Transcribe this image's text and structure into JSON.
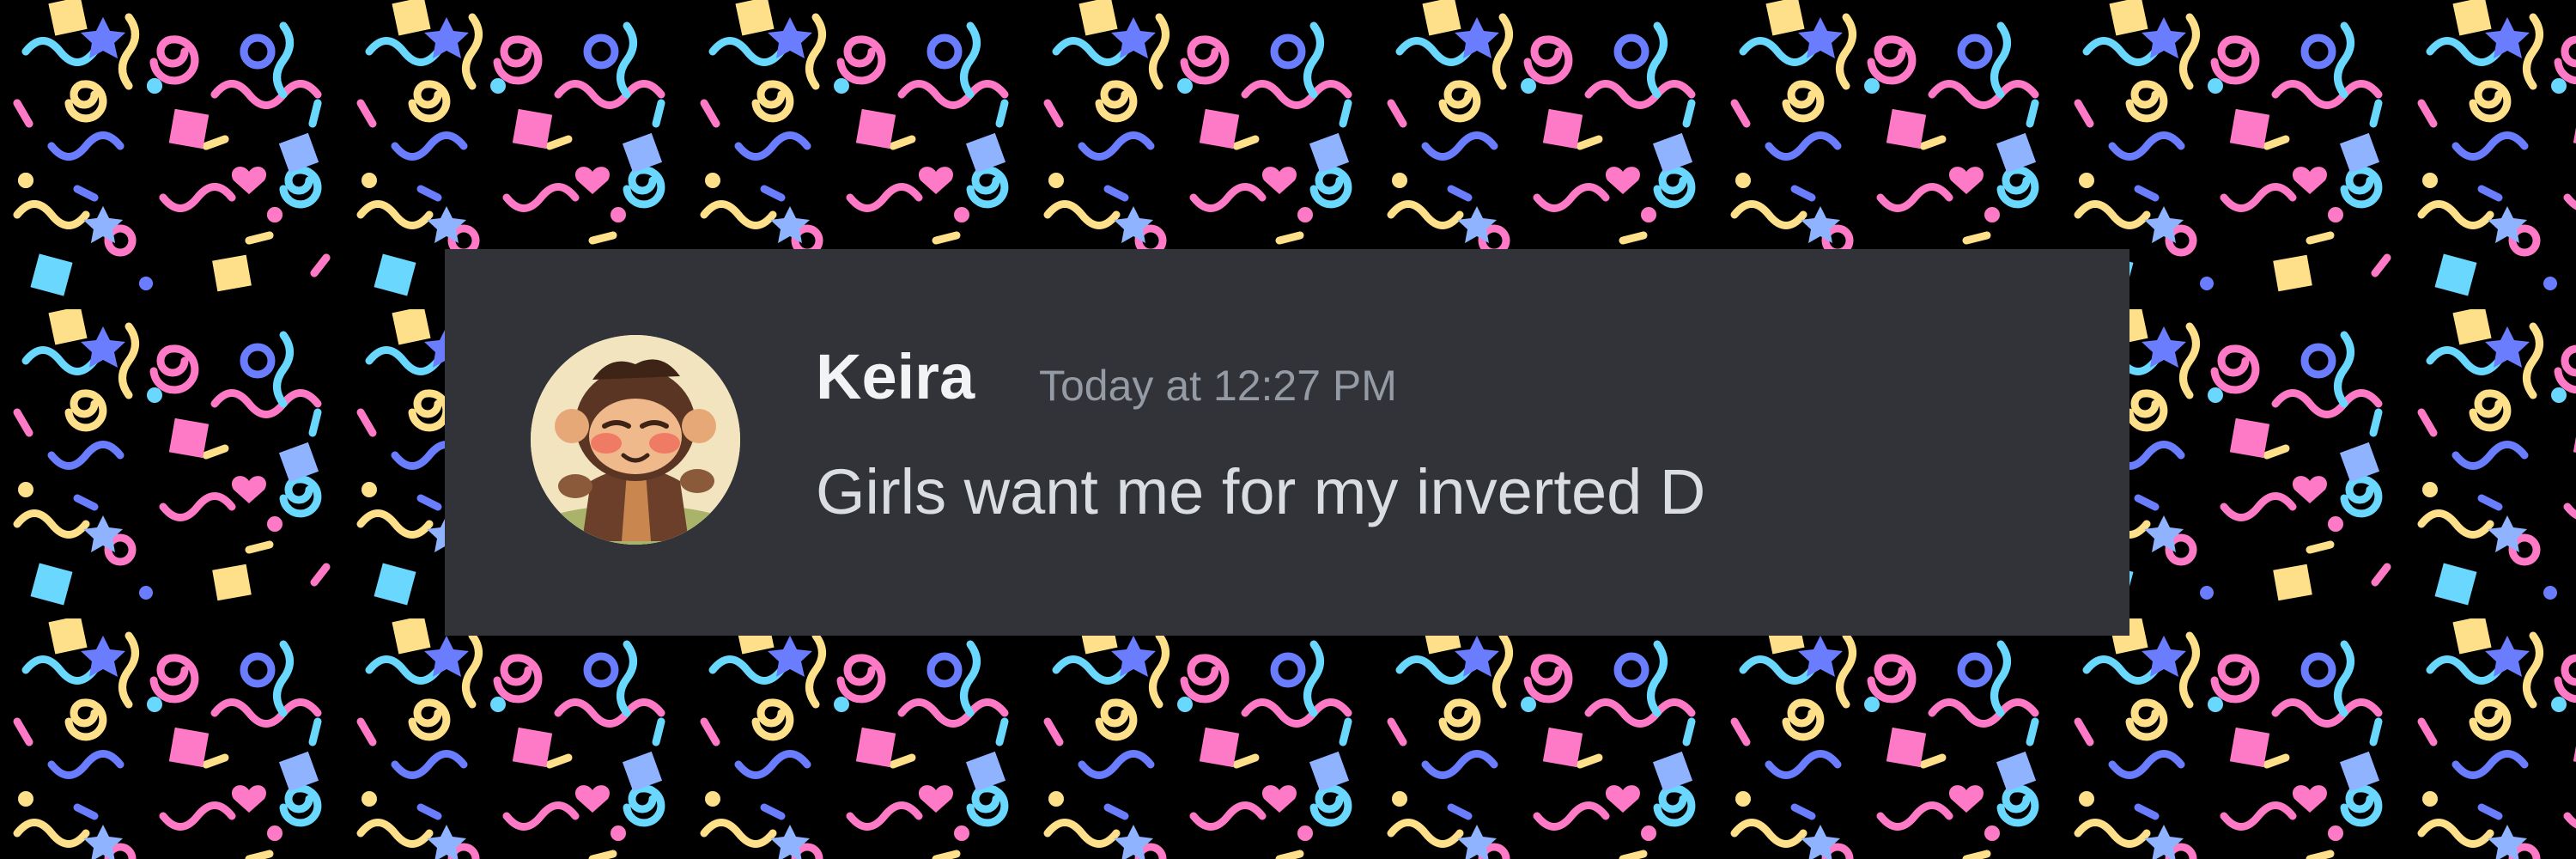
{
  "background": {
    "color": "#000000",
    "confetti_colors": [
      "#ff7ac6",
      "#ffe08a",
      "#6ad7ff",
      "#6b7dff",
      "#8fb3ff"
    ]
  },
  "message": {
    "card_color": "#313338",
    "author": "Keira",
    "author_color": "#f2f3f5",
    "timestamp": "Today at 12:27 PM",
    "timestamp_color": "#949ba4",
    "content": "Girls want me for my inverted D",
    "content_color": "#dbdee1",
    "avatar_icon": "monkey-avatar"
  }
}
